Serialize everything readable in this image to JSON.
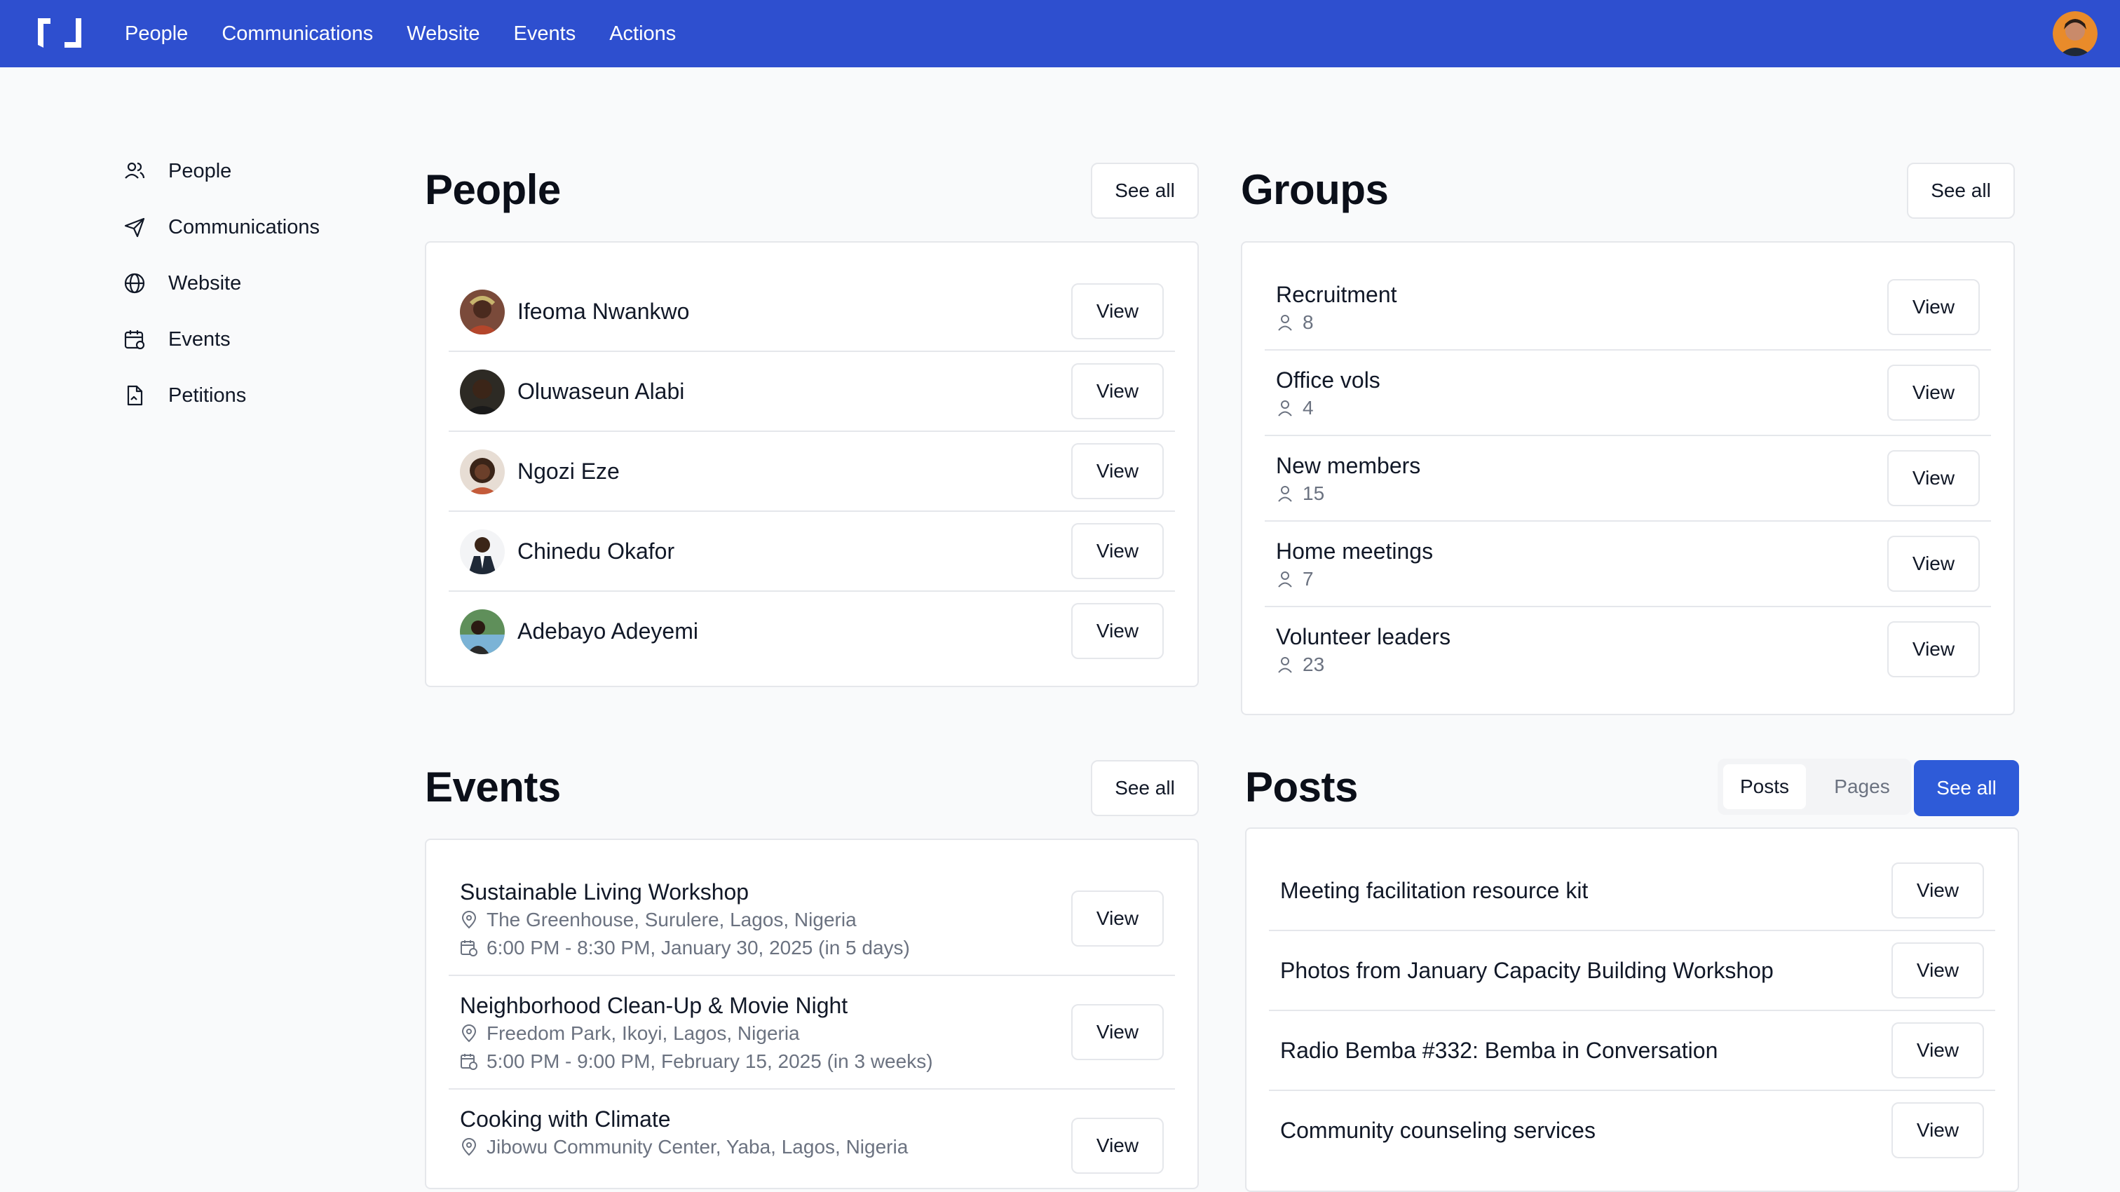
{
  "topnav": {
    "items": [
      "People",
      "Communications",
      "Website",
      "Events",
      "Actions"
    ]
  },
  "sidebar": {
    "items": [
      {
        "label": "People",
        "icon": "users-icon"
      },
      {
        "label": "Communications",
        "icon": "paper-plane-icon"
      },
      {
        "label": "Website",
        "icon": "globe-icon"
      },
      {
        "label": "Events",
        "icon": "calendar-icon"
      },
      {
        "label": "Petitions",
        "icon": "document-icon"
      }
    ]
  },
  "people": {
    "title": "People",
    "see_all": "See all",
    "items": [
      {
        "name": "Ifeoma Nwankwo",
        "view": "View"
      },
      {
        "name": "Oluwaseun Alabi",
        "view": "View"
      },
      {
        "name": "Ngozi Eze",
        "view": "View"
      },
      {
        "name": "Chinedu Okafor",
        "view": "View"
      },
      {
        "name": "Adebayo Adeyemi",
        "view": "View"
      }
    ]
  },
  "groups": {
    "title": "Groups",
    "see_all": "See all",
    "items": [
      {
        "name": "Recruitment",
        "count": "8",
        "view": "View"
      },
      {
        "name": "Office vols",
        "count": "4",
        "view": "View"
      },
      {
        "name": "New members",
        "count": "15",
        "view": "View"
      },
      {
        "name": "Home meetings",
        "count": "7",
        "view": "View"
      },
      {
        "name": "Volunteer leaders",
        "count": "23",
        "view": "View"
      }
    ]
  },
  "events": {
    "title": "Events",
    "see_all": "See all",
    "items": [
      {
        "name": "Sustainable Living Workshop",
        "location": "The Greenhouse, Surulere, Lagos, Nigeria",
        "time": "6:00 PM - 8:30 PM, January 30, 2025 (in 5 days)",
        "view": "View"
      },
      {
        "name": "Neighborhood Clean-Up & Movie Night",
        "location": "Freedom Park, Ikoyi, Lagos, Nigeria",
        "time": "5:00 PM - 9:00 PM, February 15, 2025 (in 3 weeks)",
        "view": "View"
      },
      {
        "name": "Cooking with Climate",
        "location": "Jibowu Community Center, Yaba, Lagos, Nigeria",
        "view": "View"
      }
    ]
  },
  "posts": {
    "title": "Posts",
    "tab_posts": "Posts",
    "tab_pages": "Pages",
    "see_all": "See all",
    "items": [
      {
        "name": "Meeting facilitation resource kit",
        "view": "View"
      },
      {
        "name": "Photos from January Capacity Building Workshop",
        "view": "View"
      },
      {
        "name": "Radio Bemba #332: Bemba in Conversation",
        "view": "View"
      },
      {
        "name": "Community counseling services",
        "view": "View"
      }
    ]
  },
  "colors": {
    "brand": "#2e4fcf",
    "primary_button": "#2e5bd8",
    "border": "#e5e7eb",
    "muted": "#6b7280"
  }
}
